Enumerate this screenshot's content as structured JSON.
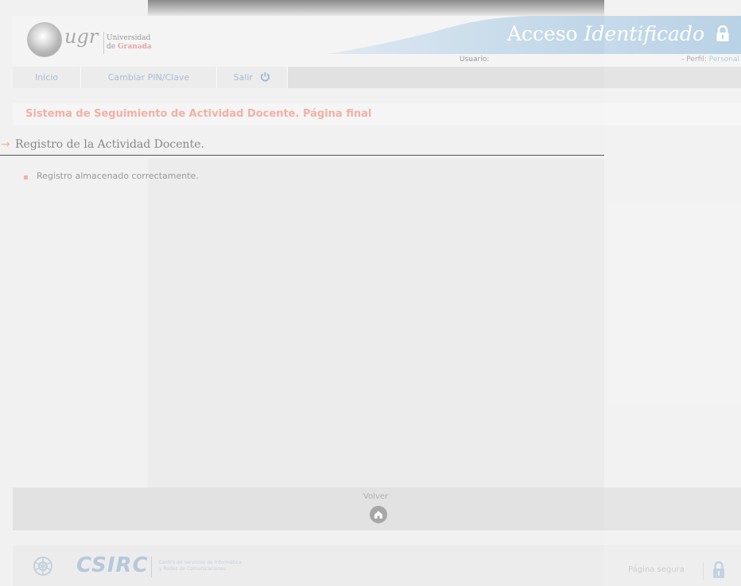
{
  "header": {
    "logo_text": "ugr",
    "university_line1": "Universidad",
    "university_line2_prefix": "de",
    "university_line2_city": "Granada",
    "title_plain": "Acceso",
    "title_italic": "Identificado",
    "usuario_label": "Usuario:",
    "perfil_label": "- Perfil:",
    "perfil_value": "Personal"
  },
  "nav": {
    "items": [
      {
        "label": "Inicio"
      },
      {
        "label": "Cambiar PIN/Clave"
      },
      {
        "label": "Salir"
      }
    ]
  },
  "page": {
    "title": "Sistema de Seguimiento de Actividad Docente. Página final",
    "section": "Registro de la Actividad Docente.",
    "message": "Registro almacenado correctamente."
  },
  "actions": {
    "volver_label": "Volver"
  },
  "footer": {
    "brand": "CSIRC",
    "desc_line1": "Centro de Servicios de Informática",
    "desc_line2": "y Redes de Comunicaciones",
    "secure_label": "Página segura"
  },
  "colors": {
    "accent_red": "#f2b0a5",
    "link_blue": "#a8bcd2",
    "header_blue": "#a7c5e0"
  }
}
